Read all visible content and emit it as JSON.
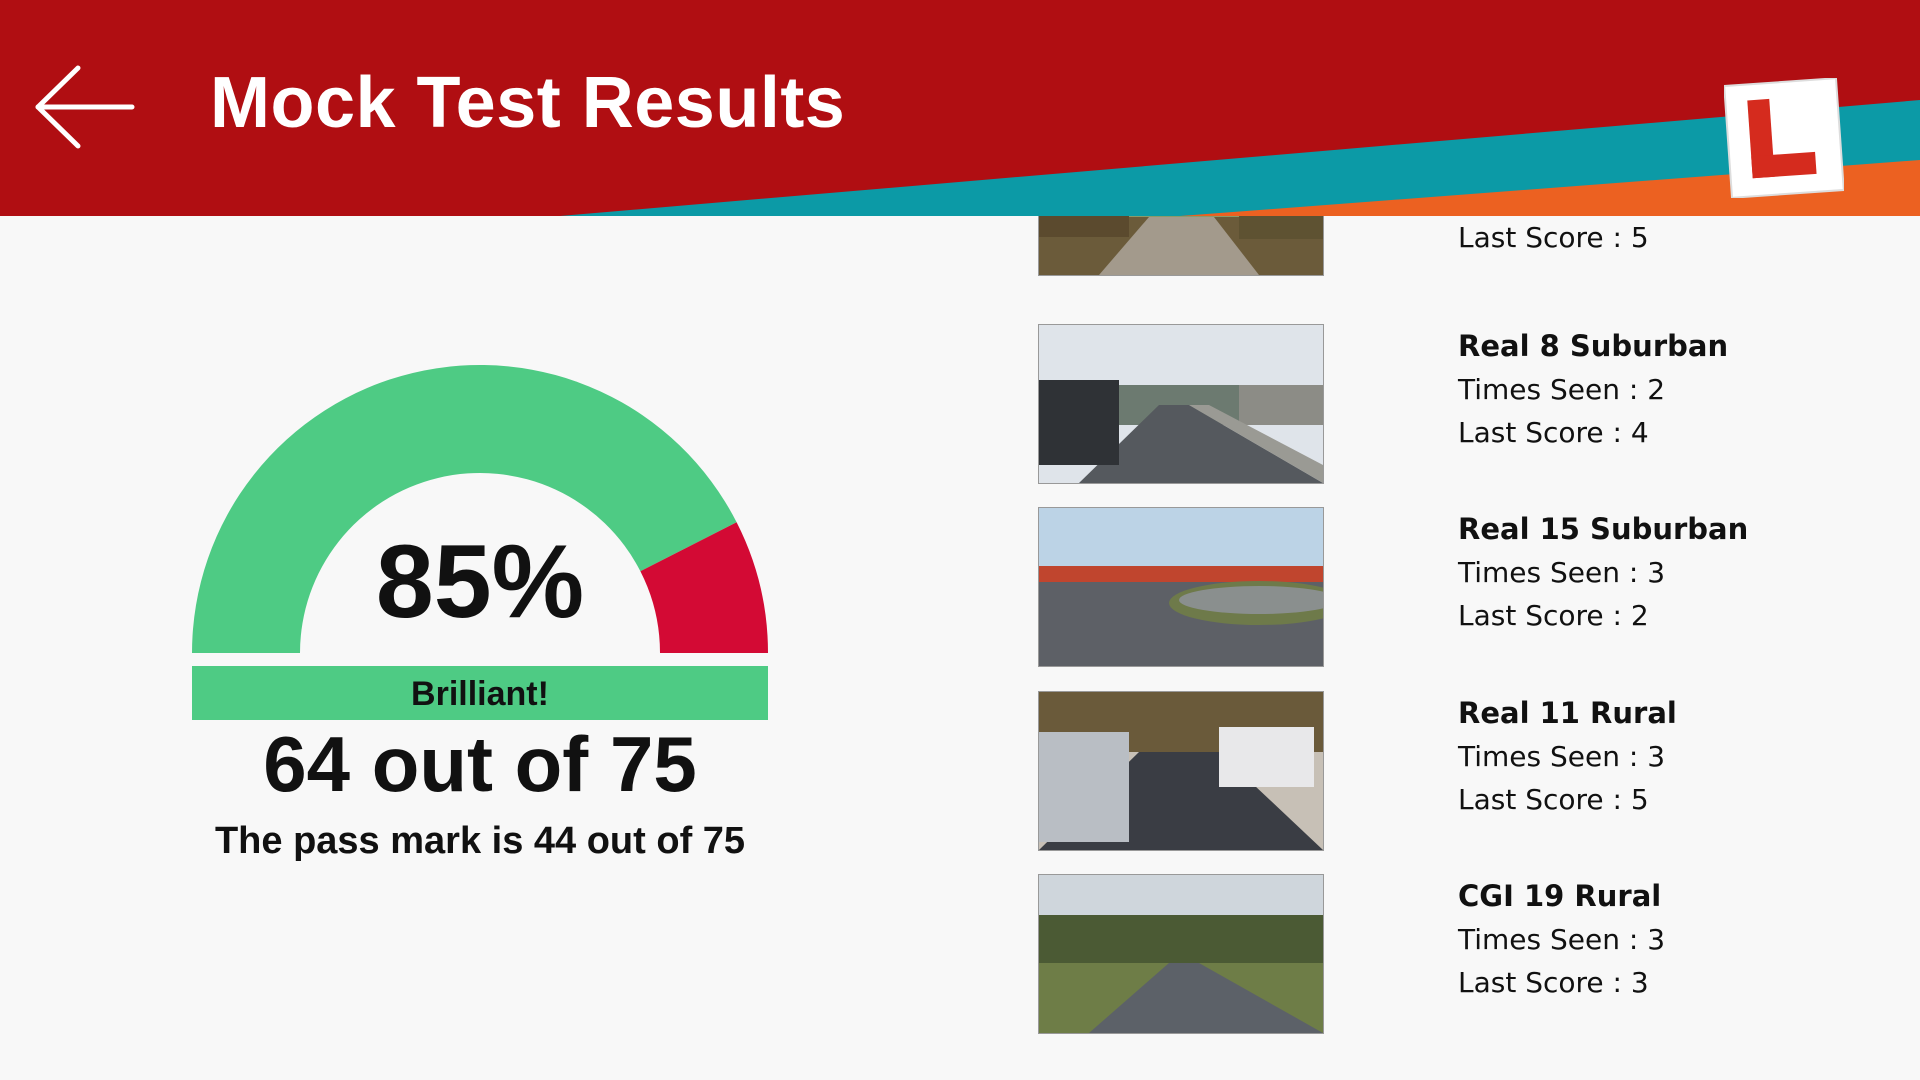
{
  "header": {
    "title": "Mock Test Results",
    "back_icon": "arrow-left-icon",
    "logo_icon": "learner-l-plate-icon"
  },
  "colors": {
    "header_red": "#b00e12",
    "teal": "#0c9aa6",
    "orange": "#ec6121",
    "gauge_green": "#4ecb84",
    "gauge_red": "#d30a34"
  },
  "result": {
    "percent": "85%",
    "percent_value": 85,
    "rating": "Brilliant!",
    "score_text": "64 out of 75",
    "pass_mark_text": "The pass mark is 44 out of 75"
  },
  "clips": [
    {
      "name": "",
      "times_seen": "",
      "last_score": "Last Score : 5"
    },
    {
      "name": "Real 8 Suburban",
      "times_seen": "Times Seen : 2",
      "last_score": "Last Score : 4"
    },
    {
      "name": "Real 15 Suburban",
      "times_seen": "Times Seen : 3",
      "last_score": "Last Score : 2"
    },
    {
      "name": "Real 11 Rural",
      "times_seen": "Times Seen : 3",
      "last_score": "Last Score : 5"
    },
    {
      "name": "CGI 19 Rural",
      "times_seen": "Times Seen : 3",
      "last_score": "Last Score : 3"
    }
  ]
}
